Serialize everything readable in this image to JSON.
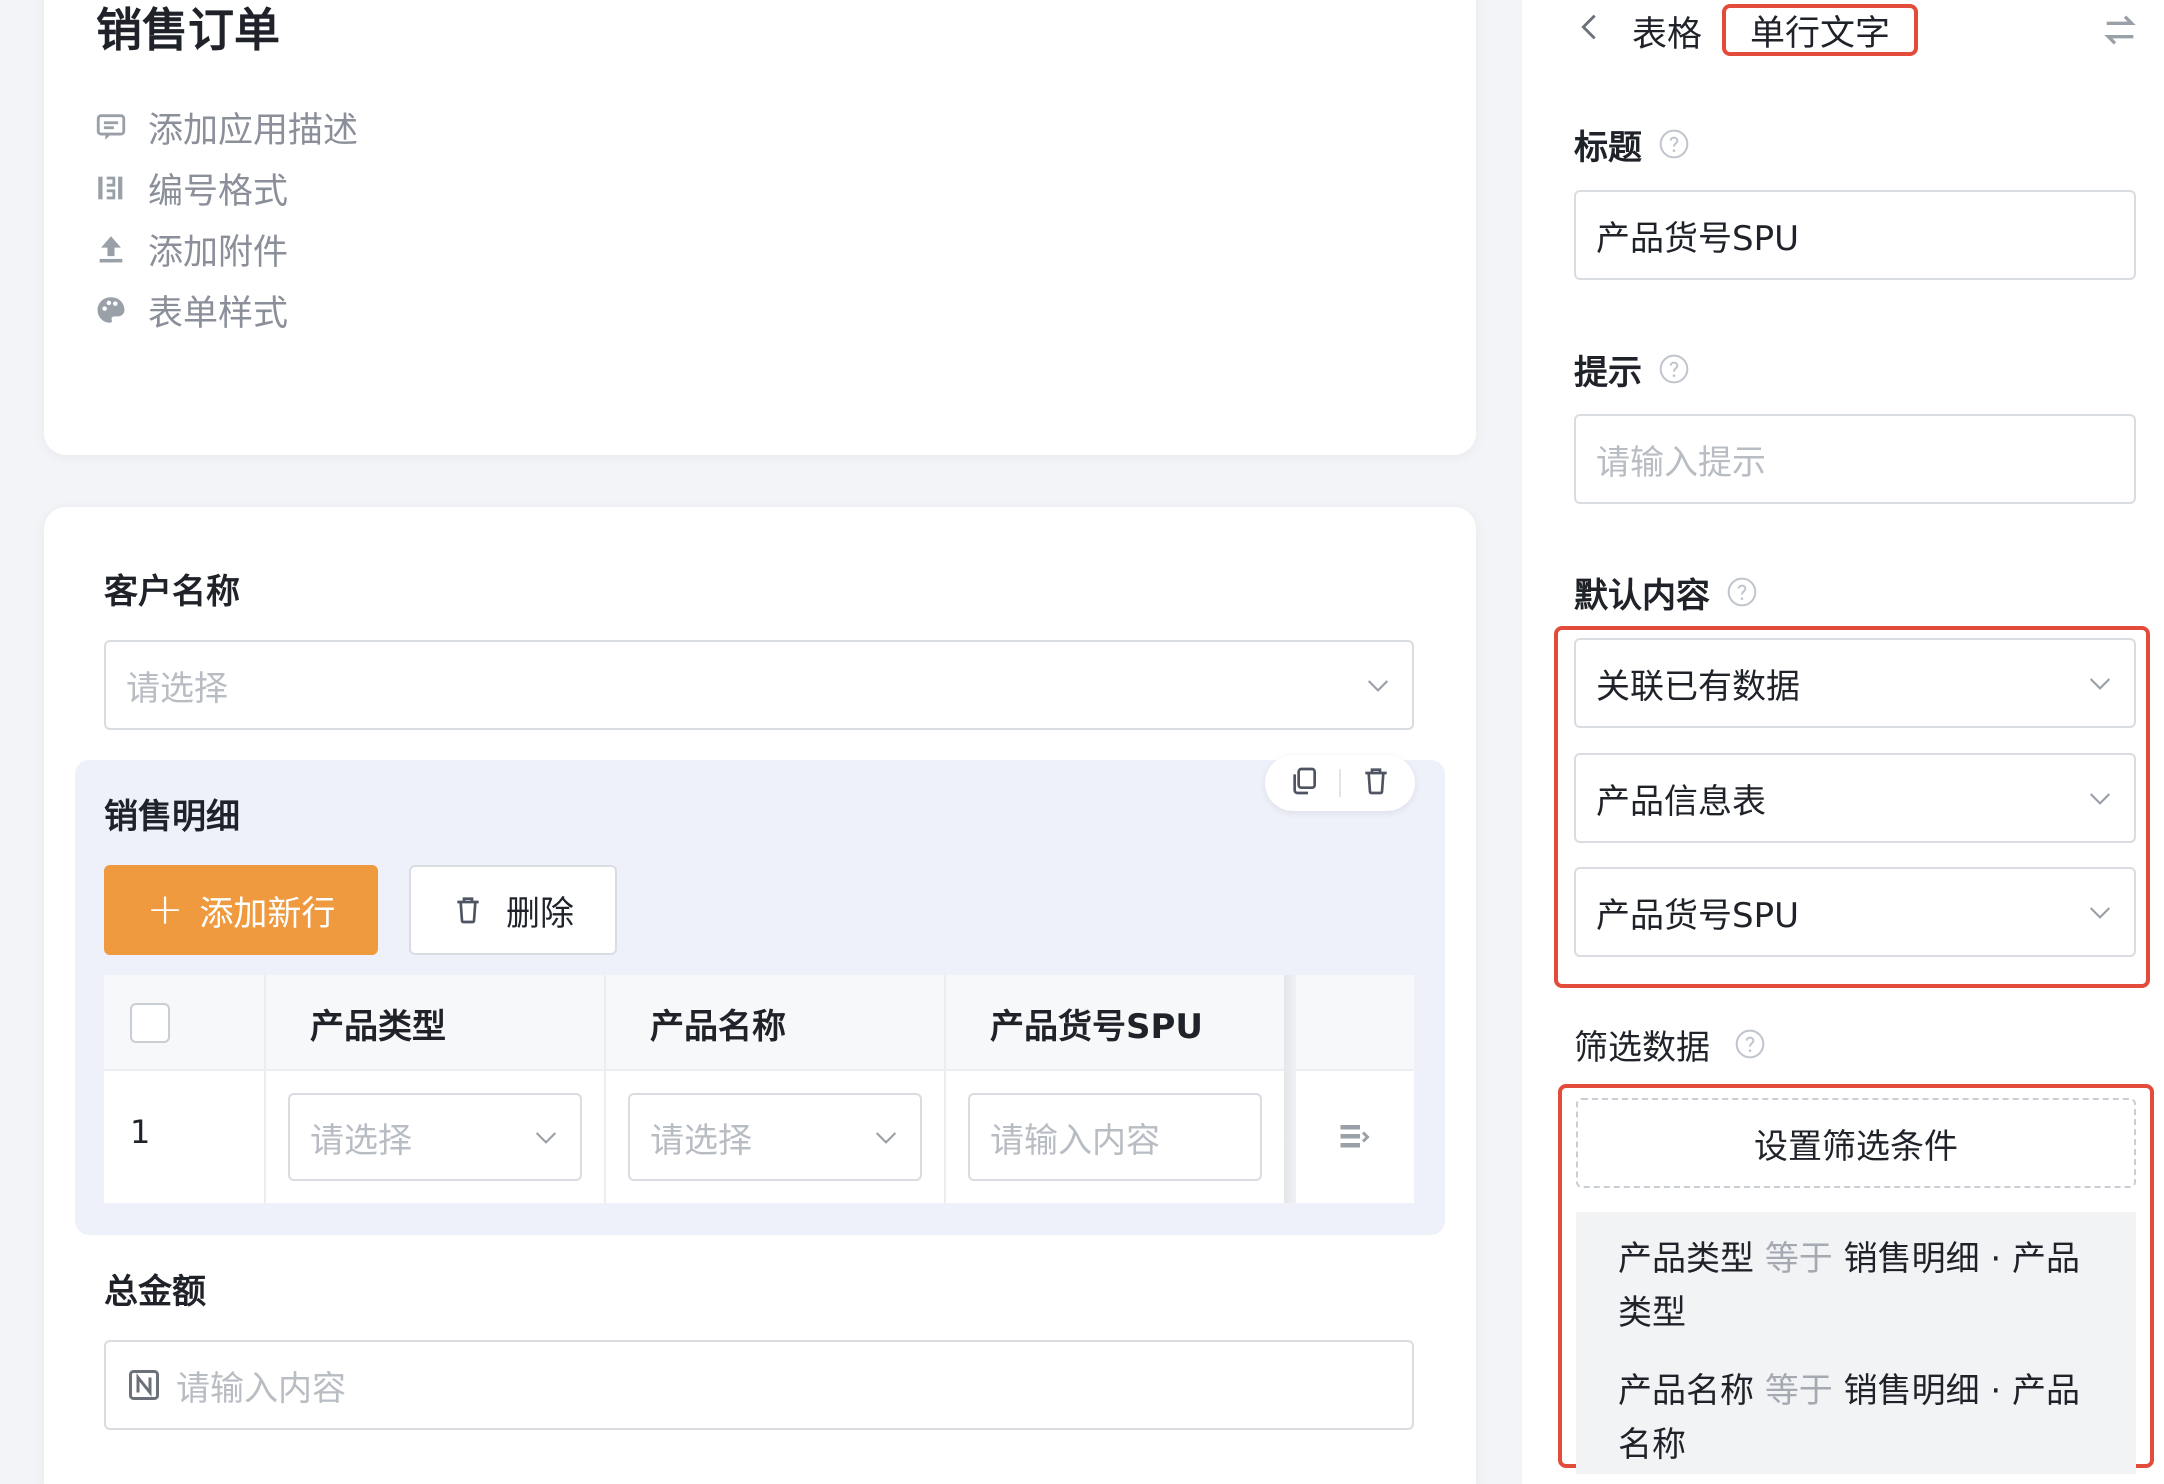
{
  "app": {
    "title": "销售订单",
    "menu": [
      {
        "icon": "comment-icon",
        "label": "添加应用描述"
      },
      {
        "icon": "number-format-icon",
        "label": "编号格式"
      },
      {
        "icon": "upload-icon",
        "label": "添加附件"
      },
      {
        "icon": "palette-icon",
        "label": "表单样式"
      }
    ]
  },
  "form": {
    "customer": {
      "label": "客户名称",
      "placeholder": "请选择"
    },
    "detail": {
      "label": "销售明细",
      "add_button": "添加新行",
      "delete_button": "删除",
      "columns": [
        "产品类型",
        "产品名称",
        "产品货号SPU"
      ],
      "row": {
        "index": "1",
        "cells": [
          "请选择",
          "请选择",
          "请输入内容"
        ]
      }
    },
    "total": {
      "label": "总金额",
      "placeholder": "请输入内容"
    }
  },
  "panel": {
    "breadcrumb_parent": "表格",
    "breadcrumb_current": "单行文字",
    "title_label": "标题",
    "title_value": "产品货号SPU",
    "hint_label": "提示",
    "hint_placeholder": "请输入提示",
    "default_label": "默认内容",
    "default_selects": [
      "关联已有数据",
      "产品信息表",
      "产品货号SPU"
    ],
    "filter_label": "筛选数据",
    "filter_button": "设置筛选条件",
    "conditions": [
      {
        "field": "产品类型",
        "op": "等于",
        "value": "销售明细 · 产品类型"
      },
      {
        "field": "产品名称",
        "op": "等于",
        "value": "销售明细 · 产品名称"
      }
    ]
  },
  "colors": {
    "accent_orange": "#ef9a3f",
    "highlight_red": "#e34b3b",
    "detail_bg": "#eef0fa"
  }
}
